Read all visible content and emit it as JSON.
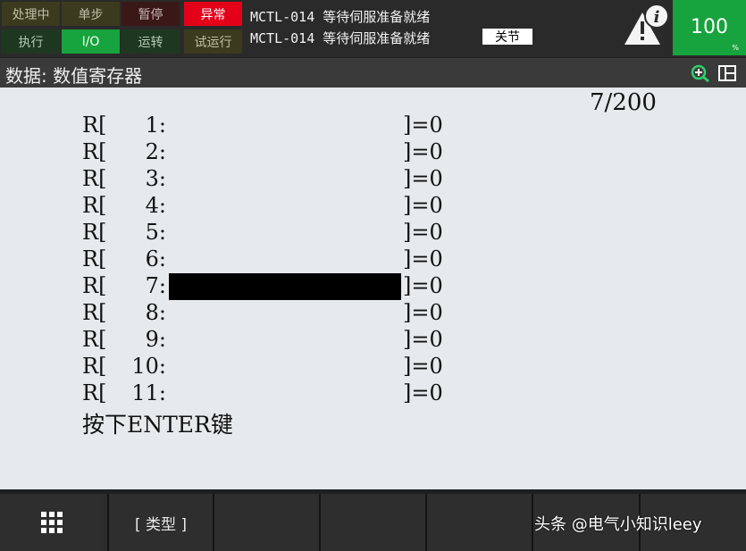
{
  "status_buttons": [
    {
      "label": "处理中",
      "state": "dark-olive"
    },
    {
      "label": "单步",
      "state": "dark-olive"
    },
    {
      "label": "暂停",
      "state": "dark-red"
    },
    {
      "label": "异常",
      "state": "red"
    },
    {
      "label": "执行",
      "state": "dark-green"
    },
    {
      "label": "I/O",
      "state": "green"
    },
    {
      "label": "运转",
      "state": "dark-green"
    },
    {
      "label": "试运行",
      "state": "dark-olive"
    }
  ],
  "alarm": {
    "line1": "MCTL-014 等待伺服准备就绪",
    "line2": "MCTL-014 等待伺服准备就绪",
    "joint_label": "关节"
  },
  "warning_icon": "warning-info-icon",
  "speed": {
    "value": "100",
    "unit": "%"
  },
  "title": "数据: 数值寄存器",
  "header_icons": {
    "zoom": "zoom-in-icon",
    "layout": "split-window-icon"
  },
  "position_counter": "7/200",
  "registers": [
    {
      "prefix": "R[",
      "index": "1:",
      "value": "]=0"
    },
    {
      "prefix": "R[",
      "index": "2:",
      "value": "]=0"
    },
    {
      "prefix": "R[",
      "index": "3:",
      "value": "]=0"
    },
    {
      "prefix": "R[",
      "index": "4:",
      "value": "]=0"
    },
    {
      "prefix": "R[",
      "index": "5:",
      "value": "]=0"
    },
    {
      "prefix": "R[",
      "index": "6:",
      "value": "]=0"
    },
    {
      "prefix": "R[",
      "index": "7:",
      "value": "]=0",
      "selected": true
    },
    {
      "prefix": "R[",
      "index": "8:",
      "value": "]=0"
    },
    {
      "prefix": "R[",
      "index": "9:",
      "value": "]=0"
    },
    {
      "prefix": "R[",
      "index": "10:",
      "value": "]=0"
    },
    {
      "prefix": "R[",
      "index": "11:",
      "value": "]=0"
    }
  ],
  "prompt": "按下ENTER键",
  "function_keys": [
    {
      "label": "",
      "icon": "grid-menu-icon"
    },
    {
      "label": "[ 类型 ]"
    },
    {
      "label": ""
    },
    {
      "label": ""
    },
    {
      "label": ""
    },
    {
      "label": ""
    }
  ],
  "watermark": "头条 @电气小知识leey",
  "colors": {
    "alarm_red": "#e5001a",
    "active_green": "#17a33d",
    "content_bg": "#e6eaec"
  }
}
